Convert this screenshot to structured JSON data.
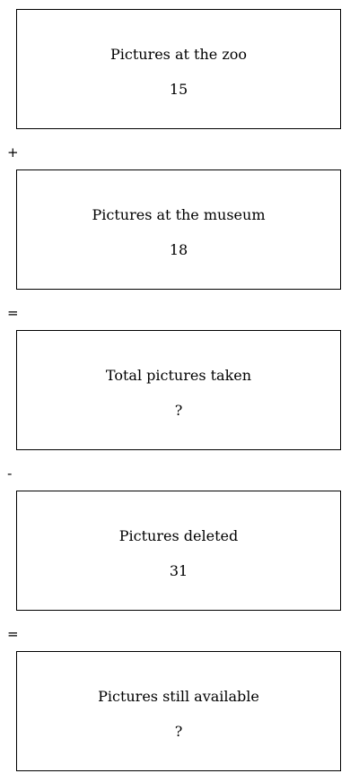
{
  "boxes": [
    {
      "label": "Pictures at the zoo",
      "value": "15"
    },
    {
      "label": "Pictures at the museum",
      "value": "18"
    },
    {
      "label": "Total pictures taken",
      "value": "?"
    },
    {
      "label": "Pictures deleted",
      "value": "31"
    },
    {
      "label": "Pictures still available",
      "value": "?"
    }
  ],
  "operators": [
    "+",
    "=",
    "-",
    "="
  ]
}
